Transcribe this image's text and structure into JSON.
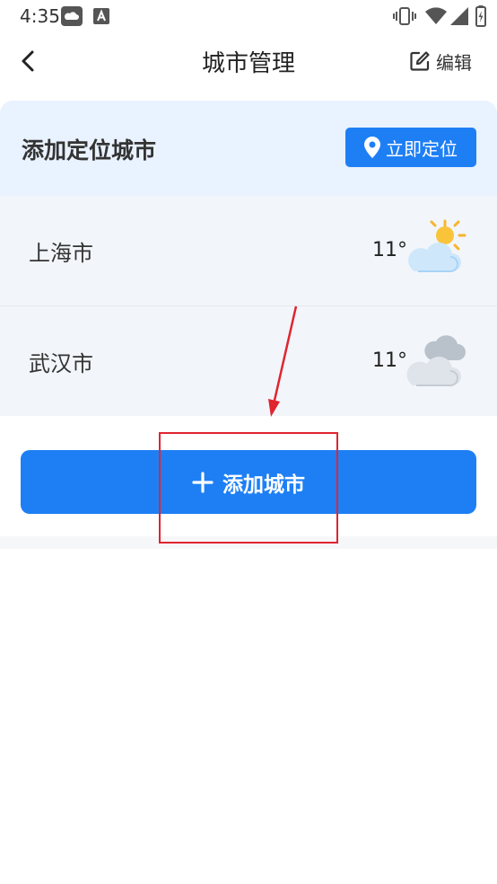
{
  "status_bar": {
    "time": "4:35",
    "icons": [
      "weather-cloud-icon",
      "font-a-icon",
      "vibrate-icon",
      "wifi-icon",
      "signal-icon",
      "battery-icon"
    ]
  },
  "header": {
    "title": "城市管理",
    "edit_label": "编辑",
    "icons": [
      "back-chevron-icon",
      "edit-pencil-icon"
    ]
  },
  "location_card": {
    "title": "添加定位城市",
    "button_label": "立即定位",
    "button_icon": "location-pin-icon"
  },
  "cities": [
    {
      "name": "上海市",
      "temperature": "11°",
      "icon": "partly-cloudy-icon"
    },
    {
      "name": "武汉市",
      "temperature": "11°",
      "icon": "cloudy-icon"
    }
  ],
  "add_city": {
    "label": "添加城市",
    "icon": "plus-icon"
  },
  "colors": {
    "accent": "#1e7ff5",
    "card_bg": "#e9f2ff",
    "row_bg": "#f2f5fa",
    "annotation": "#e0242f"
  }
}
